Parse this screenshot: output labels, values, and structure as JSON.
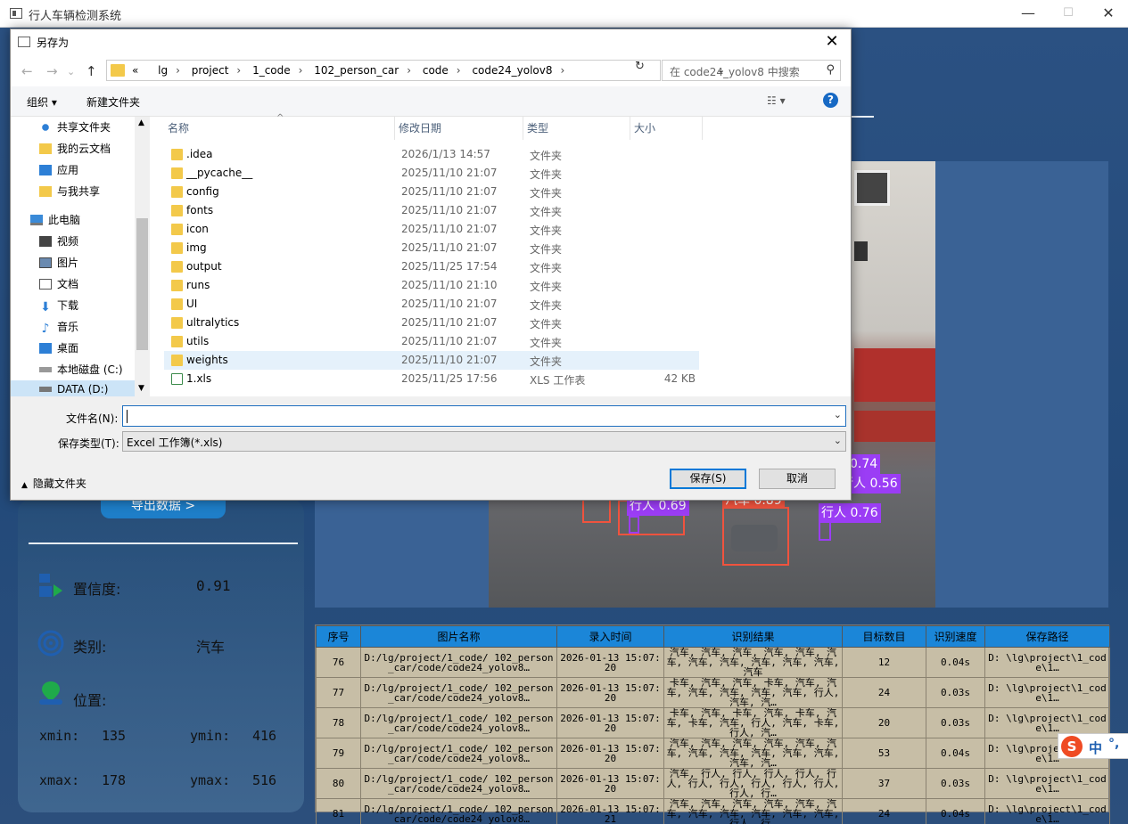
{
  "app": {
    "title": "行人车辆检测系统",
    "minimize": "—",
    "maximize": "☐",
    "close": "✕",
    "export_button": "导出数据 >",
    "info": {
      "confidence_label": "置信度:",
      "confidence_value": "0.91",
      "class_label": "类别:",
      "class_value": "汽车",
      "position_label": "位置:",
      "xmin_label": "xmin:",
      "xmin_value": "135",
      "ymin_label": "ymin:",
      "ymin_value": "416",
      "xmax_label": "xmax:",
      "xmax_value": "178",
      "ymax_label": "ymax:",
      "ymax_value": "516"
    },
    "detections": [
      {
        "label": "0.74",
        "color": "#9b3df5"
      },
      {
        "label": "行人 0.56",
        "color": "#9b3df5"
      },
      {
        "label": "行人 0.69",
        "color": "#9b3df5"
      },
      {
        "label": "汽车 0.89",
        "color": "#f0533e"
      },
      {
        "label": "行人 0.76",
        "color": "#9b3df5"
      }
    ],
    "table": {
      "headers": [
        "序号",
        "图片名称",
        "录入时间",
        "识别结果",
        "目标数目",
        "识别速度",
        "保存路径"
      ],
      "rows": [
        {
          "id": "76",
          "name": "D:/lg/project/1_code/ 102_person_car/code/code24_yolov8…",
          "time": "2026-01-13 15:07:20",
          "result": "汽车, 汽车, 汽车, 汽车, 汽车, 汽车, 汽车, 汽车, 汽车, 汽车, 汽车, 汽车",
          "count": "12",
          "speed": "0.04s",
          "path": "D: \\lg\\project\\1_code\\1…"
        },
        {
          "id": "77",
          "name": "D:/lg/project/1_code/ 102_person_car/code/code24_yolov8…",
          "time": "2026-01-13 15:07:20",
          "result": "卡车, 汽车, 汽车, 卡车, 汽车, 汽车, 汽车, 汽车, 汽车, 汽车, 行人, 汽车, 汽…",
          "count": "24",
          "speed": "0.03s",
          "path": "D: \\lg\\project\\1_code\\1…"
        },
        {
          "id": "78",
          "name": "D:/lg/project/1_code/ 102_person_car/code/code24_yolov8…",
          "time": "2026-01-13 15:07:20",
          "result": "卡车, 汽车, 卡车, 汽车, 卡车, 汽车, 卡车, 汽车, 行人, 汽车, 卡车, 行人, 汽…",
          "count": "20",
          "speed": "0.03s",
          "path": "D: \\lg\\project\\1_code\\1…"
        },
        {
          "id": "79",
          "name": "D:/lg/project/1_code/ 102_person_car/code/code24_yolov8…",
          "time": "2026-01-13 15:07:20",
          "result": "汽车, 汽车, 汽车, 汽车, 汽车, 汽车, 汽车, 汽车, 汽车, 汽车, 汽车, 汽车, 汽…",
          "count": "53",
          "speed": "0.04s",
          "path": "D: \\lg\\project\\1_code\\1…"
        },
        {
          "id": "80",
          "name": "D:/lg/project/1_code/ 102_person_car/code/code24_yolov8…",
          "time": "2026-01-13 15:07:20",
          "result": "汽车, 行人, 行人, 行人, 行人, 行人, 行人, 行人, 行人, 行人, 行人, 行人, 行…",
          "count": "37",
          "speed": "0.03s",
          "path": "D: \\lg\\project\\1_code\\1…"
        },
        {
          "id": "81",
          "name": "D:/lg/project/1_code/ 102_person_car/code/code24_yolov8…",
          "time": "2026-01-13 15:07:21",
          "result": "汽车, 汽车, 汽车, 汽车, 汽车, 汽车, 汽车, 汽车, 汽车, 汽车, 汽车, 行人, 行…",
          "count": "24",
          "speed": "0.04s",
          "path": "D: \\lg\\project\\1_code\\1…"
        }
      ]
    },
    "ime": {
      "logo": "S",
      "lang": "中",
      "punct": "°,"
    }
  },
  "dialog": {
    "title": "另存为",
    "close": "✕",
    "breadcrumbs": [
      "«",
      "lg",
      "project",
      "1_code",
      "102_person_car",
      "code",
      "code24_yolov8"
    ],
    "search_placeholder": "在 code24_yolov8 中搜索",
    "toolbar": {
      "organize": "组织 ▾",
      "new_folder": "新建文件夹",
      "view": "☷ ▾",
      "help": "?"
    },
    "nav": [
      {
        "label": "共享文件夹",
        "icon": "share-icon",
        "indent": 1
      },
      {
        "label": "我的云文档",
        "icon": "folder-icon",
        "indent": 1
      },
      {
        "label": "应用",
        "icon": "apps-icon",
        "indent": 1
      },
      {
        "label": "与我共享",
        "icon": "folder-icon",
        "indent": 1
      },
      {
        "label": "此电脑",
        "icon": "computer-icon",
        "indent": 0
      },
      {
        "label": "视频",
        "icon": "video-icon",
        "indent": 1
      },
      {
        "label": "图片",
        "icon": "picture-icon",
        "indent": 1
      },
      {
        "label": "文档",
        "icon": "document-icon",
        "indent": 1
      },
      {
        "label": "下载",
        "icon": "download-icon",
        "indent": 1
      },
      {
        "label": "音乐",
        "icon": "music-icon",
        "indent": 1
      },
      {
        "label": "桌面",
        "icon": "desktop-icon",
        "indent": 1
      },
      {
        "label": "本地磁盘 (C:)",
        "icon": "disk-icon",
        "indent": 1
      },
      {
        "label": "DATA (D:)",
        "icon": "disk-icon",
        "indent": 1
      }
    ],
    "columns": [
      "名称",
      "修改日期",
      "类型",
      "大小"
    ],
    "files": [
      {
        "name": ".idea",
        "date": "2026/1/13 14:57",
        "type": "文件夹",
        "size": ""
      },
      {
        "name": "__pycache__",
        "date": "2025/11/10 21:07",
        "type": "文件夹",
        "size": ""
      },
      {
        "name": "config",
        "date": "2025/11/10 21:07",
        "type": "文件夹",
        "size": ""
      },
      {
        "name": "fonts",
        "date": "2025/11/10 21:07",
        "type": "文件夹",
        "size": ""
      },
      {
        "name": "icon",
        "date": "2025/11/10 21:07",
        "type": "文件夹",
        "size": ""
      },
      {
        "name": "img",
        "date": "2025/11/10 21:07",
        "type": "文件夹",
        "size": ""
      },
      {
        "name": "output",
        "date": "2025/11/25 17:54",
        "type": "文件夹",
        "size": ""
      },
      {
        "name": "runs",
        "date": "2025/11/10 21:10",
        "type": "文件夹",
        "size": ""
      },
      {
        "name": "UI",
        "date": "2025/11/10 21:07",
        "type": "文件夹",
        "size": ""
      },
      {
        "name": "ultralytics",
        "date": "2025/11/10 21:07",
        "type": "文件夹",
        "size": ""
      },
      {
        "name": "utils",
        "date": "2025/11/10 21:07",
        "type": "文件夹",
        "size": ""
      },
      {
        "name": "weights",
        "date": "2025/11/10 21:07",
        "type": "文件夹",
        "size": ""
      },
      {
        "name": "1.xls",
        "date": "2025/11/25 17:56",
        "type": "XLS 工作表",
        "size": "42 KB"
      }
    ],
    "filename_label": "文件名(N):",
    "filename_value": "",
    "filetype_label": "保存类型(T):",
    "filetype_value": "Excel 工作簿(*.xls)",
    "hide_folders": "隐藏文件夹",
    "save_button": "保存(S)",
    "cancel_button": "取消"
  }
}
